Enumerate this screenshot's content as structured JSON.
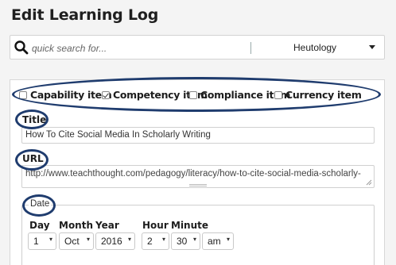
{
  "page": {
    "title": "Edit Learning Log"
  },
  "search": {
    "placeholder": "quick search for...",
    "scope": "Heutology"
  },
  "item_types": [
    {
      "label": "Capability item",
      "checked": false
    },
    {
      "label": "Competency item",
      "checked": true
    },
    {
      "label": "Compliance item",
      "checked": false
    },
    {
      "label": "Currency item",
      "checked": false
    }
  ],
  "title_field": {
    "label": "Title",
    "value": "How To Cite Social Media In Scholarly Writing"
  },
  "url_field": {
    "label": "URL",
    "value": "http://www.teachthought.com/pedagogy/literacy/how-to-cite-social-media-scholarly-"
  },
  "date": {
    "legend": "Date",
    "labels": {
      "day": "Day",
      "month": "Month",
      "year": "Year",
      "hour": "Hour",
      "minute": "Minute"
    },
    "values": {
      "day": "1",
      "month": "Oct",
      "year": "2016",
      "hour": "2",
      "minute": "30",
      "ampm": "am"
    }
  },
  "colors": {
    "annotation": "#1f3c6e",
    "panel_border": "#d7d7d7",
    "background": "#f4f4f4"
  },
  "icons": {
    "search": "search-icon",
    "dropdown": "chevron-down-icon",
    "resize": "resize-handle-icon"
  }
}
